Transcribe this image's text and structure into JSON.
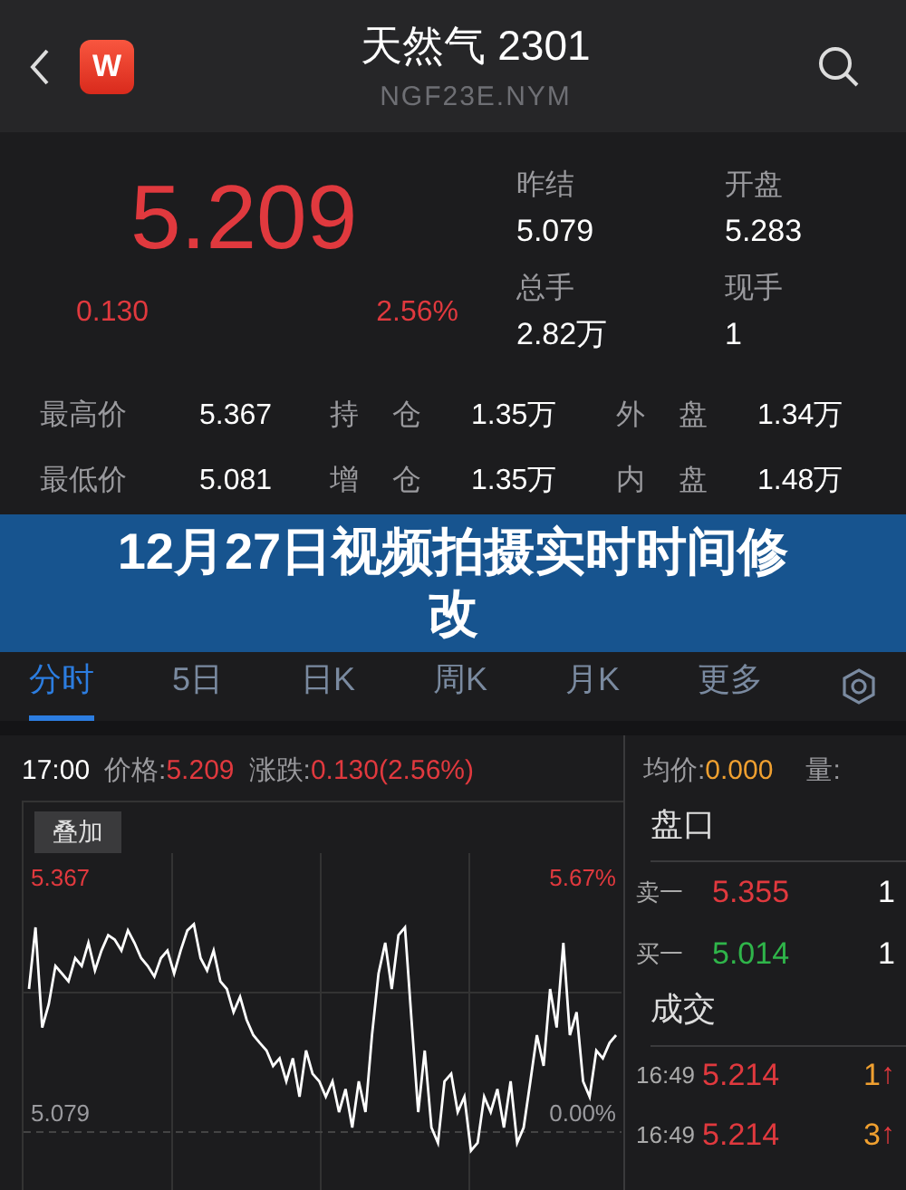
{
  "header": {
    "logo": "W",
    "title": "天然气 2301",
    "code": "NGF23E.NYM"
  },
  "quote": {
    "price": "5.209",
    "change": "0.130",
    "change_pct": "2.56%",
    "stats": [
      {
        "label": "昨结",
        "value": "5.079"
      },
      {
        "label": "开盘",
        "value": "5.283"
      },
      {
        "label": "总手",
        "value": "2.82万"
      },
      {
        "label": "现手",
        "value": "1"
      }
    ]
  },
  "details": [
    [
      {
        "label": "最高价",
        "value": "5.367"
      },
      {
        "label": "持 仓",
        "value": "1.35万"
      },
      {
        "label": "外 盘",
        "value": "1.34万"
      }
    ],
    [
      {
        "label": "最低价",
        "value": "5.081"
      },
      {
        "label": "增 仓",
        "value": "1.35万"
      },
      {
        "label": "内 盘",
        "value": "1.48万"
      }
    ]
  ],
  "tabs": [
    {
      "label": "分时",
      "selected": true
    },
    {
      "label": "5日",
      "selected": false
    },
    {
      "label": "日K",
      "selected": false
    },
    {
      "label": "周K",
      "selected": false
    },
    {
      "label": "月K",
      "selected": false
    },
    {
      "label": "更多",
      "selected": false
    }
  ],
  "chart_header": {
    "time": "17:00",
    "price_label": "价格:",
    "price": "5.209",
    "change_label": "涨跌:",
    "change": "0.130(2.56%)"
  },
  "chart": {
    "overlay_button": "叠加",
    "high": "5.367",
    "high_pct": "5.67%",
    "base": "5.079",
    "base_pct": "0.00%"
  },
  "side": {
    "avg_label": "均价:",
    "avg": "0.000",
    "vol_label": "量:",
    "book_title": "盘口",
    "book": [
      {
        "label": "卖一",
        "price": "5.355",
        "qty": "1",
        "color": "#e0393e"
      },
      {
        "label": "买一",
        "price": "5.014",
        "qty": "1",
        "color": "#2fb54a"
      }
    ],
    "trades_title": "成交",
    "trades": [
      {
        "time": "16:49",
        "price": "5.214",
        "qty": "1",
        "arrow": "↑"
      },
      {
        "time": "16:49",
        "price": "5.214",
        "qty": "3",
        "arrow": "↑"
      }
    ]
  },
  "banner": {
    "title": "12月27日视频拍摄实时时间修改"
  }
}
